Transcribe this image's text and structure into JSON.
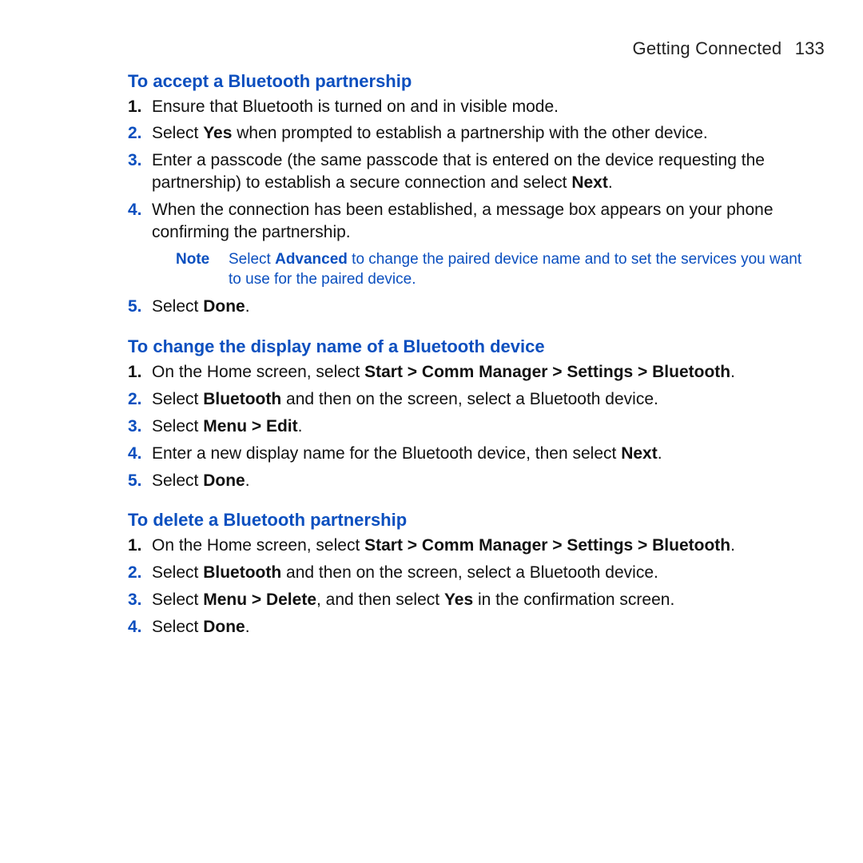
{
  "header": {
    "section": "Getting Connected",
    "page_number": "133"
  },
  "sections": [
    {
      "title": "To accept a Bluetooth partnership",
      "steps": [
        {
          "n": "1.",
          "blue": false,
          "segments": [
            {
              "t": "Ensure that Bluetooth is turned on and in visible mode."
            }
          ]
        },
        {
          "n": "2.",
          "blue": true,
          "segments": [
            {
              "t": "Select "
            },
            {
              "t": "Yes",
              "b": true
            },
            {
              "t": " when prompted to establish a partnership with the other device."
            }
          ]
        },
        {
          "n": "3.",
          "blue": true,
          "segments": [
            {
              "t": "Enter a passcode (the same passcode that is entered on the device requesting the partnership) to establish a secure connection and select "
            },
            {
              "t": "Next",
              "b": true
            },
            {
              "t": "."
            }
          ]
        },
        {
          "n": "4.",
          "blue": true,
          "segments": [
            {
              "t": "When the connection has been established, a message box appears on your phone confirming the partnership."
            }
          ]
        }
      ],
      "note": {
        "label": "Note",
        "segments": [
          {
            "t": "Select "
          },
          {
            "t": "Advanced",
            "b": true
          },
          {
            "t": " to change the paired device name and to set the services you want to use for the paired device."
          }
        ]
      },
      "steps_after_note": [
        {
          "n": "5.",
          "blue": true,
          "segments": [
            {
              "t": "Select "
            },
            {
              "t": "Done",
              "b": true
            },
            {
              "t": "."
            }
          ]
        }
      ]
    },
    {
      "title": "To change the display name of a Bluetooth device",
      "steps": [
        {
          "n": "1.",
          "blue": false,
          "segments": [
            {
              "t": "On the Home screen, select "
            },
            {
              "t": "Start > Comm Manager > Settings > Bluetooth",
              "b": true
            },
            {
              "t": "."
            }
          ]
        },
        {
          "n": "2.",
          "blue": true,
          "segments": [
            {
              "t": "Select "
            },
            {
              "t": "Bluetooth",
              "b": true
            },
            {
              "t": " and then on the screen, select a Bluetooth device."
            }
          ]
        },
        {
          "n": "3.",
          "blue": true,
          "segments": [
            {
              "t": "Select "
            },
            {
              "t": "Menu > Edit",
              "b": true
            },
            {
              "t": "."
            }
          ]
        },
        {
          "n": "4.",
          "blue": true,
          "segments": [
            {
              "t": "Enter a new display name for the Bluetooth device, then select "
            },
            {
              "t": "Next",
              "b": true
            },
            {
              "t": "."
            }
          ]
        },
        {
          "n": "5.",
          "blue": true,
          "segments": [
            {
              "t": "Select "
            },
            {
              "t": "Done",
              "b": true
            },
            {
              "t": "."
            }
          ]
        }
      ]
    },
    {
      "title": "To delete a Bluetooth partnership",
      "steps": [
        {
          "n": "1.",
          "blue": false,
          "segments": [
            {
              "t": "On the Home screen, select "
            },
            {
              "t": "Start > Comm Manager > Settings > Bluetooth",
              "b": true
            },
            {
              "t": "."
            }
          ]
        },
        {
          "n": "2.",
          "blue": true,
          "segments": [
            {
              "t": "Select "
            },
            {
              "t": "Bluetooth",
              "b": true
            },
            {
              "t": " and then on the screen, select a Bluetooth device."
            }
          ]
        },
        {
          "n": "3.",
          "blue": true,
          "segments": [
            {
              "t": "Select "
            },
            {
              "t": "Menu > Delete",
              "b": true
            },
            {
              "t": ", and then select "
            },
            {
              "t": "Yes",
              "b": true
            },
            {
              "t": " in the confirmation screen."
            }
          ]
        },
        {
          "n": "4.",
          "blue": true,
          "segments": [
            {
              "t": "Select "
            },
            {
              "t": "Done",
              "b": true
            },
            {
              "t": "."
            }
          ]
        }
      ]
    }
  ]
}
